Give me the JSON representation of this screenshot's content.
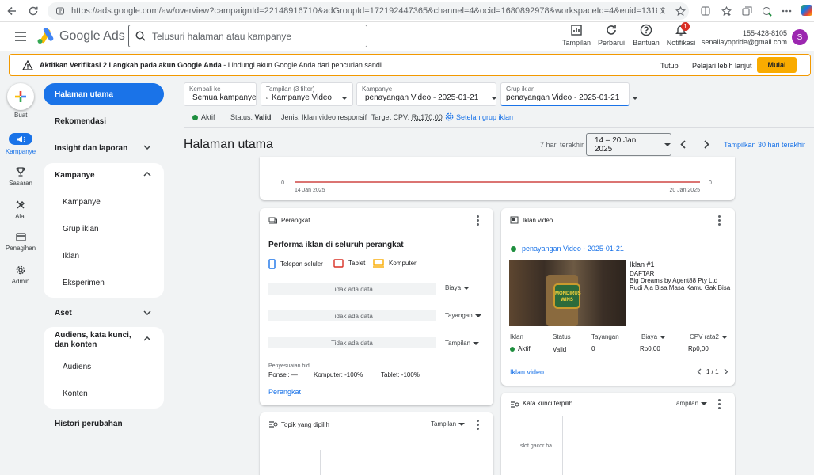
{
  "browser": {
    "url": "https://ads.google.com/aw/overview?campaignId=22148916710&adGroupId=172192447365&channel=4&ocid=1680892978&workspaceId=4&euid=1318296233&__u=9530566817&uscid=168..."
  },
  "header": {
    "product": "Google Ads",
    "search_placeholder": "Telusuri halaman atau kampanye",
    "actions": [
      {
        "label": "Tampilan",
        "icon": "chart-icon"
      },
      {
        "label": "Perbarui",
        "icon": "refresh-icon"
      },
      {
        "label": "Bantuan",
        "icon": "help-icon"
      },
      {
        "label": "Notifikasi",
        "icon": "bell-icon",
        "badge": "1"
      }
    ],
    "account_phone": "155-428-8105",
    "account_email": "senailayopride@gmail.com",
    "avatar_letter": "S"
  },
  "banner": {
    "title": "Aktifkan Verifikasi 2 Langkah pada akun Google Anda",
    "text": " - Lindungi akun Google Anda dari pencurian sandi.",
    "close": "Tutup",
    "learn_more": "Pelajari lebih lanjut",
    "start": "Mulai"
  },
  "rail": {
    "create": "Buat",
    "items": [
      {
        "label": "Kampanye",
        "icon": "megaphone-icon"
      },
      {
        "label": "Sasaran",
        "icon": "trophy-icon"
      },
      {
        "label": "Alat",
        "icon": "tools-icon"
      },
      {
        "label": "Penagihan",
        "icon": "card-icon"
      },
      {
        "label": "Admin",
        "icon": "gear-icon"
      }
    ]
  },
  "sidenav": {
    "home": "Halaman utama",
    "recommendations": "Rekomendasi",
    "insights": "Insight dan laporan",
    "campaigns_group": "Kampanye",
    "campaigns_sub": [
      "Kampanye",
      "Grup iklan",
      "Iklan",
      "Eksperimen"
    ],
    "assets": "Aset",
    "audiences_group": "Audiens, kata kunci, dan konten",
    "audiences_sub": [
      "Audiens",
      "Konten"
    ],
    "history": "Histori perubahan"
  },
  "filters": {
    "back": {
      "label": "Kembali ke",
      "value": "Semua kampanye"
    },
    "view": {
      "label": "Tampilan (3 filter)",
      "value": "Kampanye Video"
    },
    "campaign": {
      "label": "Kampanye",
      "value": "penayangan Video - 2025-01-21"
    },
    "adgroup": {
      "label": "Grup iklan",
      "value": "penayangan Video - 2025-01-21"
    }
  },
  "status": {
    "state": "Aktif",
    "status_label": "Status:",
    "status_value": "Valid",
    "type_label": "Jenis:",
    "type_value": "Iklan video responsif",
    "cpv_label": "Target CPV:",
    "cpv_value": "Rp170,00",
    "settings_link": "Setelan grup iklan"
  },
  "page": {
    "title": "Halaman utama",
    "range_label": "7 hari terakhir",
    "date_range": "14 – 20 Jan 2025",
    "show_30": "Tampilkan 30 hari terakhir"
  },
  "top_chart": {
    "y_left": "0",
    "y_right": "0",
    "x_start": "14 Jan 2025",
    "x_end": "20 Jan 2025"
  },
  "chart_data": {
    "type": "line",
    "x": [
      "14 Jan 2025",
      "20 Jan 2025"
    ],
    "series": [
      {
        "values": [
          0,
          0
        ]
      }
    ],
    "ylim": [
      0,
      0
    ]
  },
  "devices": {
    "title": "Perangkat",
    "subtitle": "Performa iklan di seluruh perangkat",
    "legend": [
      {
        "label": "Telepon seluler",
        "color": "#1a73e8"
      },
      {
        "label": "Tablet",
        "color": "#d93025"
      },
      {
        "label": "Komputer",
        "color": "#f9ab00"
      }
    ],
    "rows": [
      {
        "text": "Tidak ada data",
        "metric": "Biaya"
      },
      {
        "text": "Tidak ada data",
        "metric": "Tayangan"
      },
      {
        "text": "Tidak ada data",
        "metric": "Tampilan"
      }
    ],
    "bid_title": "Penyesuaian bid",
    "bid_phone": "Ponsel: —",
    "bid_computer": "Komputer: -100%",
    "bid_tablet": "Tablet: -100%",
    "link": "Perangkat"
  },
  "video_ad": {
    "title": "Iklan video",
    "campaign": "penayangan Video - 2025-01-21",
    "ad_name": "Iklan #1",
    "cta": "DAFTAR",
    "headline1": "Big Dreams by Agent88 Pty Ltd",
    "headline2": "Rudi Aja Bisa Masa Kamu Gak Bisa",
    "thumb_caption": "MONDIRUS WINS",
    "columns": [
      "Iklan",
      "Status",
      "Tayangan",
      "Biaya",
      "CPV rata2"
    ],
    "values": [
      "Aktif",
      "Valid",
      "0",
      "Rp0,00",
      "Rp0,00"
    ],
    "link": "Iklan video",
    "pager": "1 / 1"
  },
  "topics": {
    "title": "Topik yang dipilih",
    "dropdown": "Tampilan"
  },
  "keywords": {
    "title": "Kata kunci terpilih",
    "dropdown": "Tampilan",
    "item": "slot gacor ha..."
  }
}
